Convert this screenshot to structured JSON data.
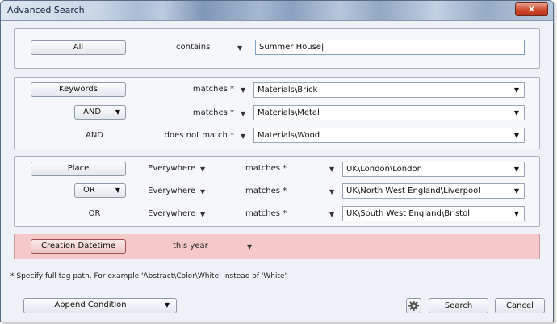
{
  "window": {
    "title": "Advanced Search",
    "close_symbol": "×"
  },
  "group_all": {
    "field_button": "All",
    "operator": "contains",
    "value": "Summer House"
  },
  "group_keywords": {
    "field_button": "Keywords",
    "rows": [
      {
        "connector": "",
        "operator": "matches *",
        "value": "Materials\\Brick"
      },
      {
        "connector": "AND",
        "operator": "matches *",
        "value": "Materials\\Metal"
      },
      {
        "connector": "AND",
        "operator": "does not match *",
        "value": "Materials\\Wood"
      }
    ]
  },
  "group_place": {
    "field_button": "Place",
    "rows": [
      {
        "connector": "",
        "scope": "Everywhere",
        "operator": "matches *",
        "value": "UK\\London\\London"
      },
      {
        "connector": "OR",
        "scope": "Everywhere",
        "operator": "matches *",
        "value": "UK\\North West England\\Liverpool"
      },
      {
        "connector": "OR",
        "scope": "Everywhere",
        "operator": "matches *",
        "value": "UK\\South West England\\Bristol"
      }
    ]
  },
  "group_datetime": {
    "field_button": "Creation Datetime",
    "operator": "this year"
  },
  "footer": {
    "note": "* Specify full tag path. For example 'Abstract\\Color\\White' instead of 'White'",
    "append_label": "Append Condition",
    "search_label": "Search",
    "cancel_label": "Cancel"
  },
  "icons": {
    "dropdown": "chevron-down-icon",
    "settings": "gear-icon"
  },
  "colors": {
    "highlight_panel": "#f5c9c9",
    "title_text": "#10213a"
  }
}
